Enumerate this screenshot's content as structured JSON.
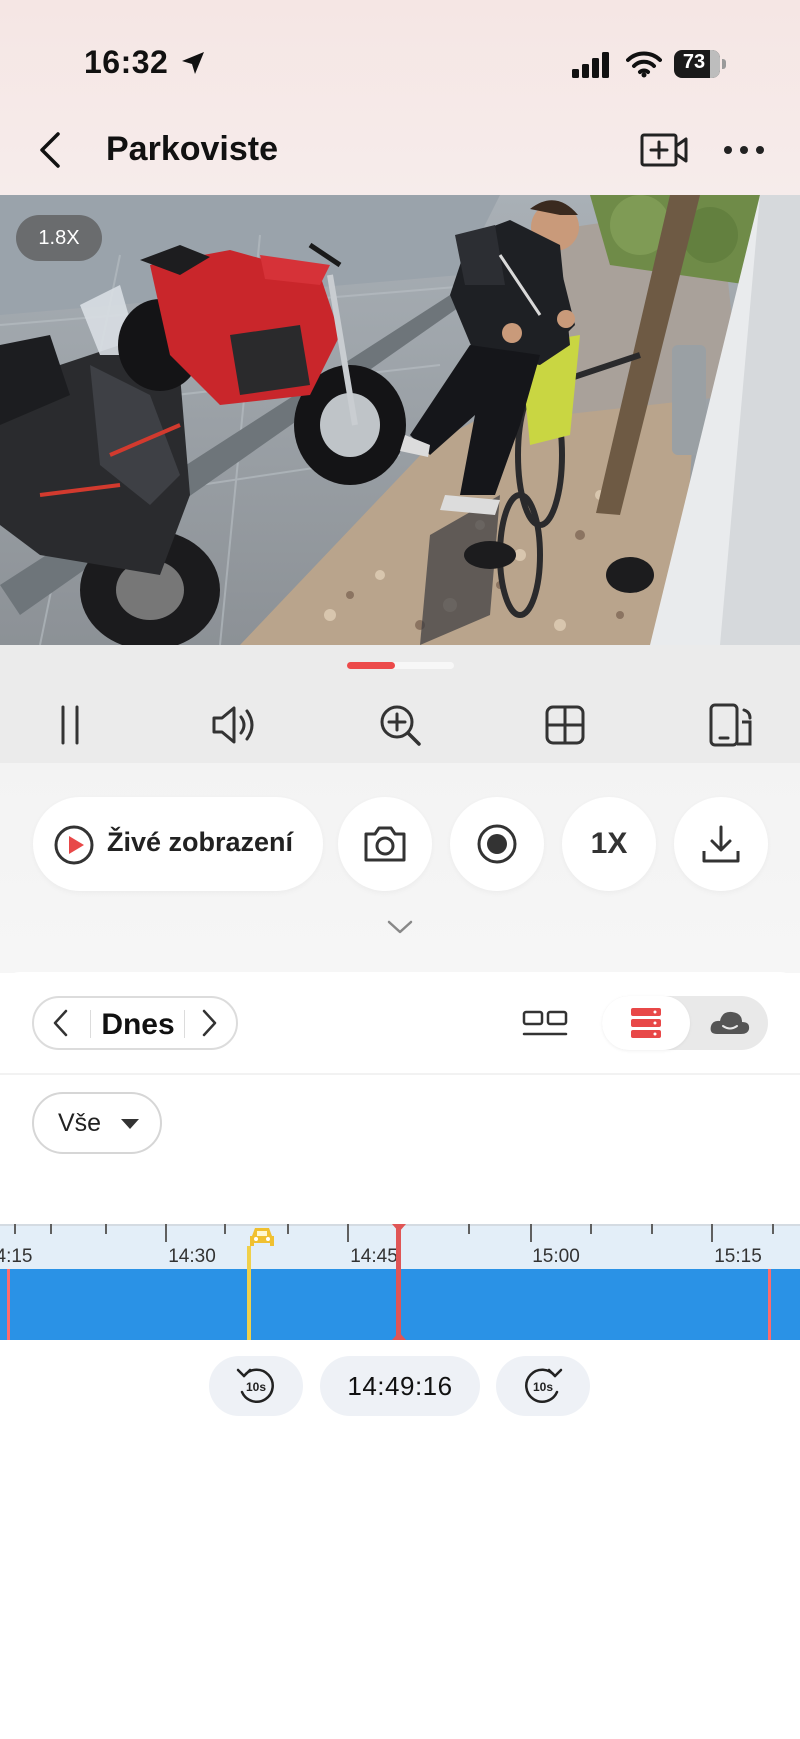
{
  "status_bar": {
    "time": "16:32",
    "battery": "73"
  },
  "header": {
    "title": "Parkoviste"
  },
  "video": {
    "zoom_badge": "1.8X"
  },
  "playback_progress": 0.45,
  "actions": {
    "live_label": "Živé zobrazení",
    "speed_label": "1X"
  },
  "date_nav": {
    "label": "Dnes"
  },
  "filter": {
    "label": "Vše"
  },
  "timeline": {
    "ticks": [
      "4:15",
      "14:30",
      "14:45",
      "15:00",
      "15:15"
    ],
    "current_time": "14:49:16"
  },
  "colors": {
    "accent": "#e84848",
    "timeline_bar": "#2a92e6",
    "event": "#f0d04a"
  }
}
